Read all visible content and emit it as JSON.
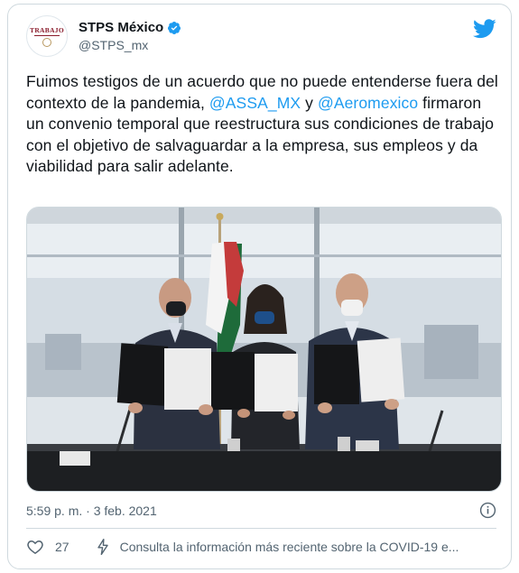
{
  "account": {
    "avatar_logo_text": "TRABAJO",
    "display_name": "STPS México",
    "handle": "@STPS_mx"
  },
  "tweet": {
    "segments": [
      {
        "text": "Fuimos testigos de un acuerdo que no puede entenderse fuera del contexto de la pandemia, ",
        "mention": false
      },
      {
        "text": "@ASSA_MX",
        "mention": true
      },
      {
        "text": " y ",
        "mention": false
      },
      {
        "text": "@Aeromexico",
        "mention": true
      },
      {
        "text": " firmaron un convenio temporal que reestructura sus condiciones de trabajo con el objetivo de salvaguardar a la empresa, sus empleos y da viabilidad para salir adelante.",
        "mention": false
      }
    ]
  },
  "photo": {
    "icon": "photo-signing-ceremony"
  },
  "meta": {
    "timestamp": "5:59 p. m. · 3 feb. 2021"
  },
  "footer": {
    "like_count": "27",
    "covid_text": "Consulta la información más reciente sobre la COVID-19 e..."
  },
  "colors": {
    "link": "#1d9bf0",
    "twitter_blue": "#1d9bf0",
    "text": "#0f1419",
    "secondary": "#536471",
    "border": "#cfd9de"
  },
  "icons": [
    "verified-badge-icon",
    "twitter-bird-icon",
    "info-icon",
    "heart-icon",
    "bolt-icon"
  ]
}
